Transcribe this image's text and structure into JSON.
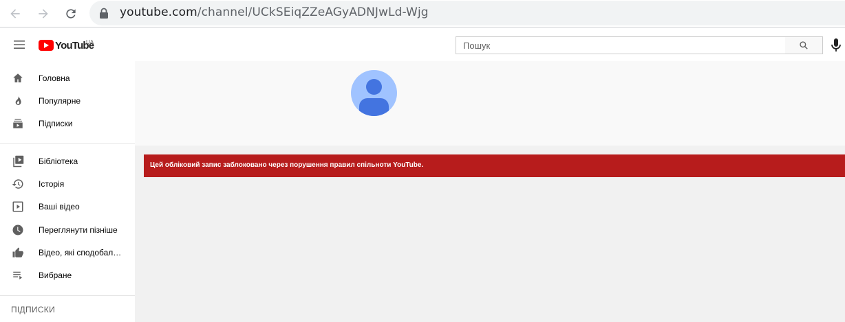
{
  "browser": {
    "url_host": "youtube.com",
    "url_path": "/channel/UCkSEiqZZeAGyADNJwLd-Wjg"
  },
  "masthead": {
    "logo_text": "YouTube",
    "country_code": "UA",
    "search_placeholder": "Пошук"
  },
  "sidebar": {
    "primary": [
      {
        "label": "Головна",
        "icon": "home-icon"
      },
      {
        "label": "Популярне",
        "icon": "trending-icon"
      },
      {
        "label": "Підписки",
        "icon": "subscriptions-icon"
      }
    ],
    "library": [
      {
        "label": "Бібліотека",
        "icon": "library-icon"
      },
      {
        "label": "Історія",
        "icon": "history-icon"
      },
      {
        "label": "Ваші відео",
        "icon": "your-videos-icon"
      },
      {
        "label": "Переглянути пізніше",
        "icon": "watch-later-icon"
      },
      {
        "label": "Відео, які сподобал…",
        "icon": "liked-videos-icon"
      },
      {
        "label": "Вибране",
        "icon": "playlist-icon"
      }
    ],
    "subscriptions_title": "ПІДПИСКИ"
  },
  "main": {
    "alert_text": "Цей обліковий запис заблоковано через порушення правил спільноти YouTube."
  },
  "colors": {
    "brand_red": "#ff0000",
    "alert_red": "#b71c1c",
    "avatar_bg": "#a0c3ff",
    "avatar_fg": "#4374e0"
  }
}
